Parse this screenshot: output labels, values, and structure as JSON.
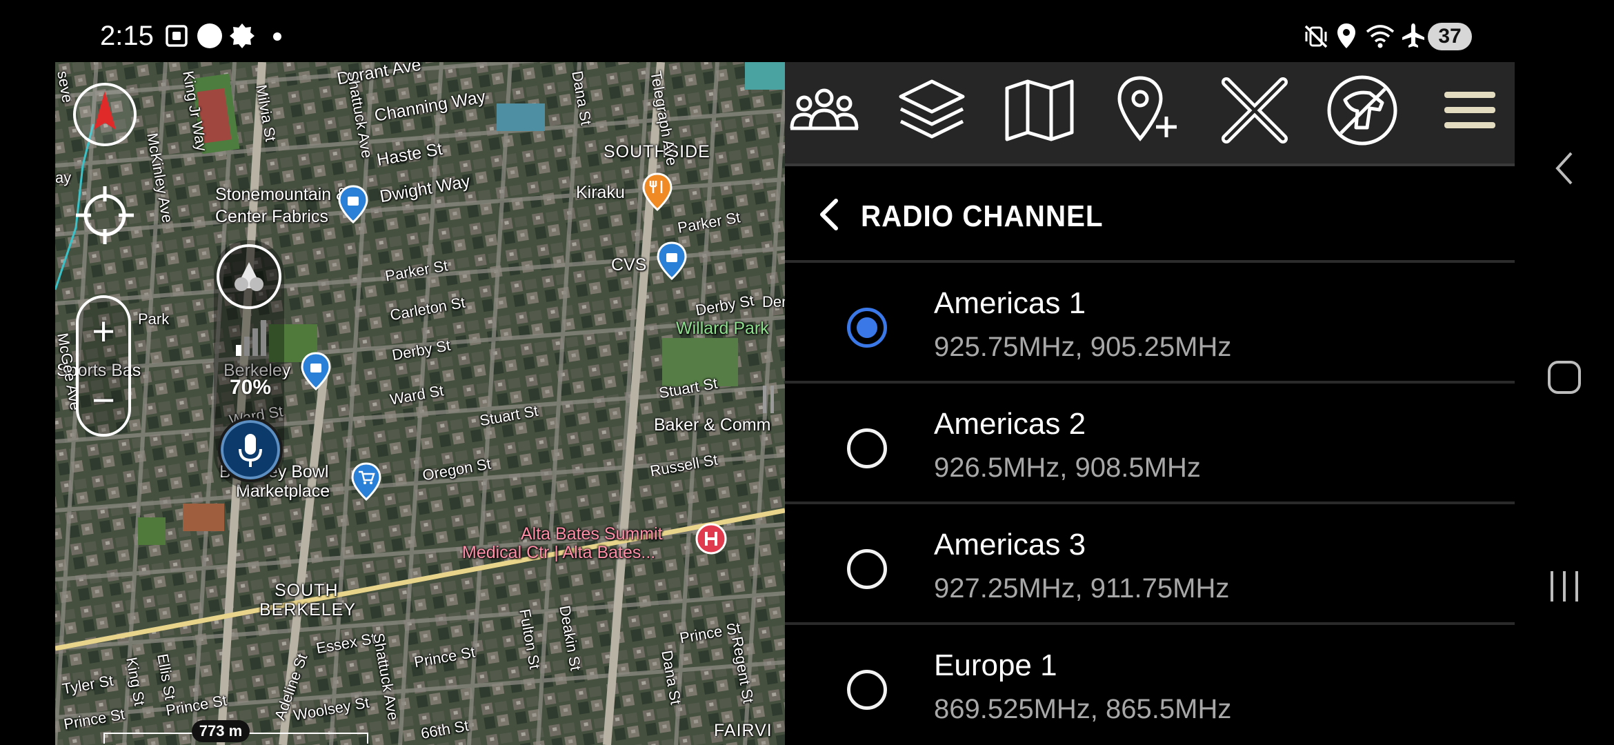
{
  "status_bar": {
    "time": "2:15",
    "battery": "37",
    "icons": [
      "screenshot-icon",
      "circle-icon",
      "badge-icon",
      "dot-icon",
      "mute-vibrate-icon",
      "location-icon",
      "wifi-calling-icon",
      "airplane-icon"
    ]
  },
  "map": {
    "labels": {
      "durant": "Durant Ave",
      "channing": "Channing Way",
      "haste": "Haste St",
      "southside": "SOUTHSIDE",
      "kiraku": "Kiraku",
      "dwight": "Dwight Way",
      "stonemountain": "Stonemountain &",
      "fabrics": "Center Fabrics",
      "parker_st_top": "Parker St",
      "parker_st": "Parker St",
      "cvs": "CVS",
      "carleton": "Carleton St",
      "derby_st_top": "Derby St",
      "derby_st": "Derby St",
      "willard": "Willard Park",
      "sports": "Sports Bas",
      "berkeley": "Berkeley",
      "ward_st": "Ward St",
      "ward_st_2": "Ward St",
      "stuart_st": "Stuart St",
      "stuart_st_2": "Stuart St",
      "baker": "Baker & Comm",
      "bowl": "Berkeley Bowl",
      "marketplace": "Marketplace",
      "oregon": "Oregon St",
      "russell": "Russell St",
      "alta1": "Alta Bates Summit",
      "alta2": "Medical Ctr | Alta Bates...",
      "south_berkeley_1": "SOUTH",
      "south_berkeley_2": "BERKELEY",
      "essex": "Essex St",
      "prince_st": "Prince St",
      "prince_st_2": "Prince St",
      "prince_st_3": "Prince St",
      "prince_st_4": "Prince St",
      "tyler": "Tyler St",
      "woolsey": "Woolsey St",
      "st_66th": "66th St",
      "fairview": "FAIRVI",
      "fulton": "Fulton St",
      "deakin": "Deakin St",
      "shattuck": "Shattuck Ave",
      "adeline": "Adeline St",
      "dana": "Dana St",
      "regent": "Regent St",
      "mckinley": "McKinley Ave",
      "mlk": "King Jr Way",
      "milvia": "Milvia St",
      "king_st": "King St",
      "ellis": "Ellis St",
      "telegraph": "Telegraph Ave",
      "dana_top": "Dana St",
      "shattuck_top": "Shattuck Ave",
      "mcgee": "McGee Ave",
      "seventh": "seve",
      "park": "Park",
      "ay": "ay",
      "der": "Der"
    },
    "signal_percent": "70%",
    "scale": "773 m"
  },
  "toolbar": {
    "items": [
      "team-icon",
      "layers-icon",
      "map-icon",
      "add-location-icon",
      "close-icon",
      "dog-tracking-icon",
      "menu-icon"
    ]
  },
  "header": {
    "title": "RADIO CHANNEL"
  },
  "channels": [
    {
      "name": "Americas 1",
      "freq": "925.75MHz, 905.25MHz",
      "selected": true
    },
    {
      "name": "Americas 2",
      "freq": "926.5MHz, 908.5MHz",
      "selected": false
    },
    {
      "name": "Americas 3",
      "freq": "927.25MHz, 911.75MHz",
      "selected": false
    },
    {
      "name": "Europe 1",
      "freq": "869.525MHz, 865.5MHz",
      "selected": false
    }
  ],
  "colors": {
    "accent": "#3b78e7",
    "toolbar_bg": "#262626",
    "freq_text": "#a8a8a8",
    "poi_blue": "#2a7fd6",
    "poi_orange": "#f08a24",
    "poi_red": "#e03a4f"
  }
}
